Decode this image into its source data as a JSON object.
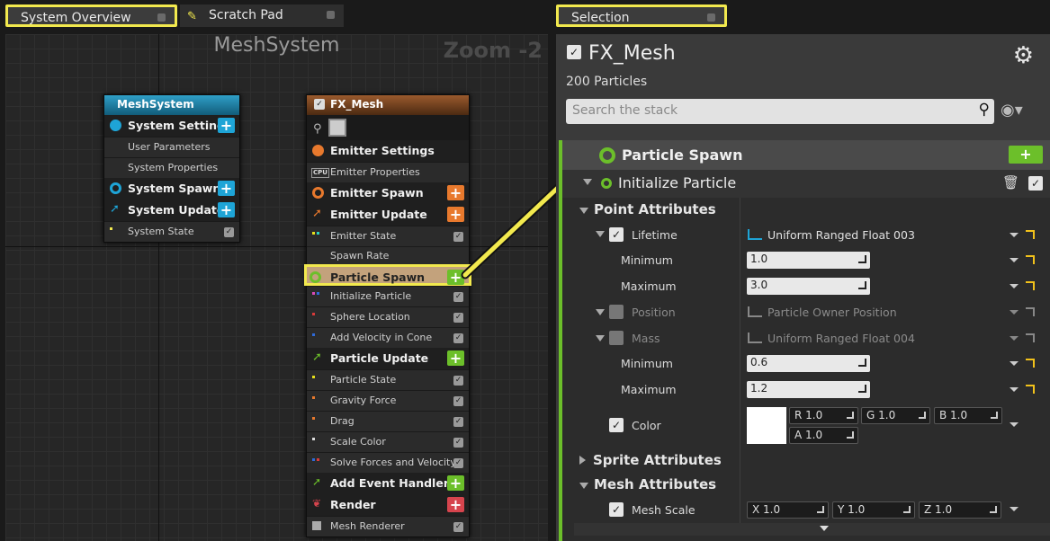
{
  "tabs": [
    {
      "label": "System Overview"
    },
    {
      "label": "Scratch Pad"
    },
    {
      "label": "Selection"
    }
  ],
  "graph": {
    "title": "MeshSystem",
    "zoom": "Zoom -2",
    "system_node": {
      "title": "MeshSystem",
      "rows": [
        "System Settings",
        "User Parameters",
        "System Properties",
        "System Spawn",
        "System Update",
        "System State"
      ]
    },
    "emitter_node": {
      "title": "FX_Mesh",
      "rows": [
        "Emitter Settings",
        "Emitter Properties",
        "Emitter Spawn",
        "Emitter Update",
        "Emitter State",
        "Spawn Rate",
        "Particle Spawn",
        "Initialize Particle",
        "Sphere Location",
        "Add Velocity in Cone",
        "Particle Update",
        "Particle State",
        "Gravity Force",
        "Drag",
        "Scale Color",
        "Solve Forces and Velocity",
        "Add Event Handler",
        "Render",
        "Mesh Renderer"
      ],
      "cpu_badge": "CPU"
    }
  },
  "selection": {
    "emitter_name": "FX_Mesh",
    "particles": "200 Particles",
    "search_placeholder": "Search the stack",
    "group_title": "Particle Spawn",
    "module_title": "Initialize Particle",
    "sections": {
      "point": "Point Attributes",
      "sprite": "Sprite Attributes",
      "mesh": "Mesh Attributes"
    },
    "lifetime": {
      "label": "Lifetime",
      "fn": "Uniform Ranged Float 003",
      "min_label": "Minimum",
      "min": "1.0",
      "max_label": "Maximum",
      "max": "3.0"
    },
    "position": {
      "label": "Position",
      "fn": "Particle Owner Position"
    },
    "mass": {
      "label": "Mass",
      "fn": "Uniform Ranged Float 004",
      "min_label": "Minimum",
      "min": "0.6",
      "max_label": "Maximum",
      "max": "1.2"
    },
    "color": {
      "label": "Color",
      "r": "R 1.0",
      "g": "G 1.0",
      "b": "B 1.0",
      "a": "A 1.0"
    },
    "mesh_scale": {
      "label": "Mesh Scale",
      "x": "X 1.0",
      "y": "Y 1.0",
      "z": "Z 1.0"
    }
  },
  "colors": {
    "highlight": "#f2e94e",
    "system": "#1ea4d6",
    "emitter": "#e8792d",
    "particle": "#6cbf2a",
    "render": "#d6444d"
  }
}
